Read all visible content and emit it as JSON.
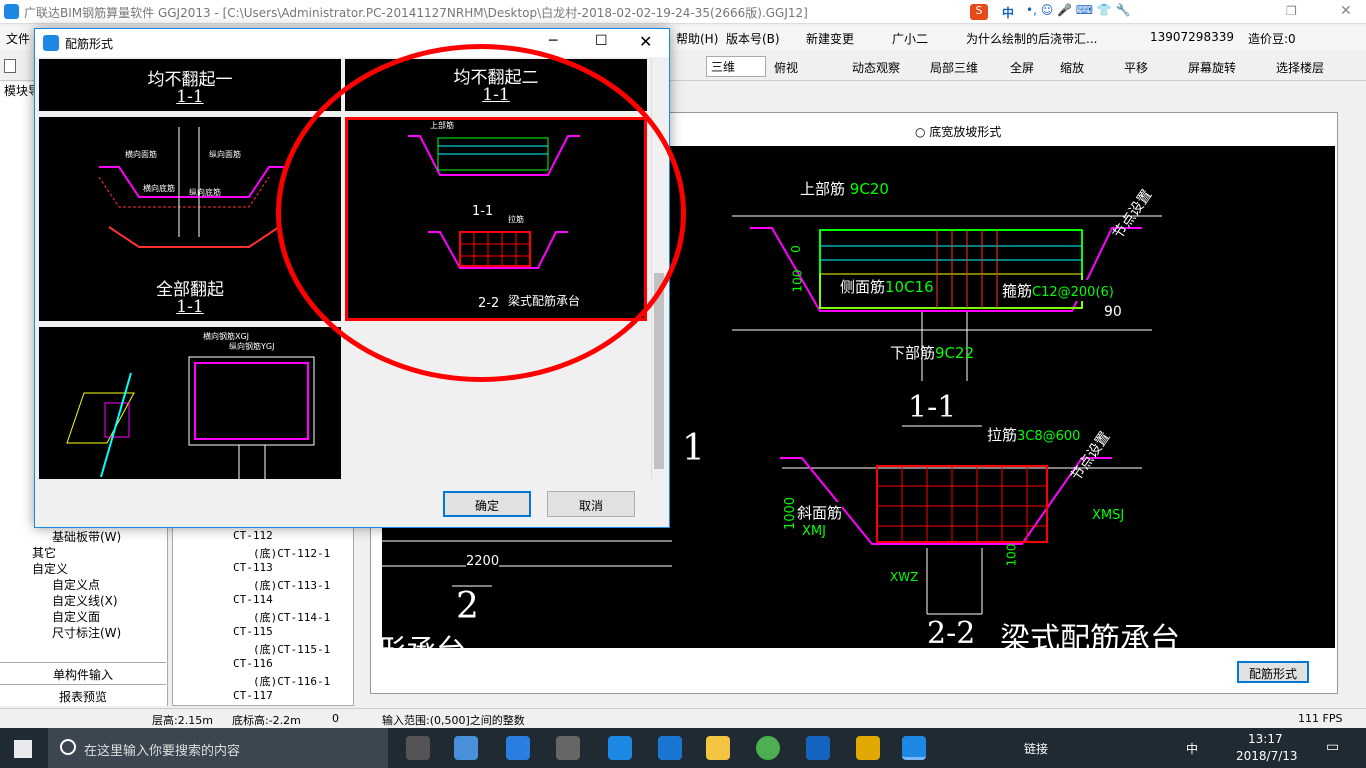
{
  "window": {
    "title": "广联达BIM钢筋算量软件 GGJ2013 - [C:\\Users\\Administrator.PC-20141127NRHM\\Desktop\\白龙村-2018-02-02-19-24-35(2666版).GGJ12]"
  },
  "menu": {
    "file": "文件",
    "help": "帮助(H)",
    "version": "版本号(B)",
    "new_change": "新建变更",
    "guangxiaoer": "广小二",
    "question": "为什么绘制的后浇带汇...",
    "phone": "13907298339",
    "cost_bean": "造价豆:0"
  },
  "ime": {
    "label": "中"
  },
  "toolbar": {
    "view3d": "三维",
    "top_view": "俯视",
    "dynamic": "动态观察",
    "local3d": "局部三维",
    "fullscreen": "全屏",
    "zoom": "缩放",
    "pan": "平移",
    "rotate": "屏幕旋转",
    "select_floor": "选择楼层"
  },
  "left": {
    "module_tab": "模块导",
    "items": [
      {
        "label": "基础板带(W)"
      },
      {
        "label": "其它"
      },
      {
        "label": "自定义"
      },
      {
        "label": "自定义点"
      },
      {
        "label": "自定义线(X)"
      },
      {
        "label": "自定义面"
      },
      {
        "label": "尺寸标注(W)"
      }
    ],
    "single_input": "单构件输入",
    "report_preview": "报表预览"
  },
  "mid_tree": {
    "items": [
      "CT-112",
      "(底)CT-112-1",
      "CT-113",
      "(底)CT-113-1",
      "CT-114",
      "(底)CT-114-1",
      "CT-115",
      "(底)CT-115-1",
      "CT-116",
      "(底)CT-116-1",
      "CT-117"
    ]
  },
  "viewer": {
    "radio_label": "底宽放坡形式",
    "rebar_form_button": "配筋形式",
    "cad": {
      "top_rebar": "上部筋",
      "top_rebar_v": "9C20",
      "node_setting": "节点设置",
      "side_rebar": "侧面筋",
      "side_rebar_v": "10C16",
      "stirrup": "箍筋",
      "stirrup_v": "C12@200(6)",
      "bottom_rebar": "下部筋",
      "bottom_rebar_v": "9C22",
      "angle": "90",
      "zero": "0",
      "dim100": "100",
      "sec11": "1-1",
      "tie": "拉筋",
      "tie_v": "3C8@600",
      "node_setting2": "节点设置",
      "slope": "斜面筋",
      "xmj": "XMJ",
      "xmsj": "XMSJ",
      "xwz": "XWZ",
      "dim1000": "1000",
      "dim100b": "100",
      "left1": "1",
      "left2": "2",
      "dim2200": "2200",
      "sec22": "2-2",
      "caption": "梁式配筋承台",
      "partial_left": "形承台"
    }
  },
  "dialog": {
    "title": "配筋形式",
    "ok": "确定",
    "cancel": "取消",
    "panels": {
      "p1_title": "均不翻起一",
      "p1_sec": "1-1",
      "p2_title": "均不翻起二",
      "p2_sec": "1-1",
      "p3_title": "全部翻起",
      "p3_sec": "1-1",
      "p3_labels": [
        "横向面筋",
        "纵向面筋",
        "横向底筋",
        "纵向底筋"
      ],
      "p4_sec1": "1-1",
      "p4_sec2": "2-2",
      "p4_caption": "梁式配筋承台",
      "p4_labels": [
        "上部筋",
        "拉筋"
      ],
      "p5_labels": [
        "横向钢筋XGJ",
        "纵向钢筋YGJ"
      ]
    }
  },
  "status": {
    "floor_height": "层高:2.15m",
    "base_elev": "底标高:-2.2m",
    "zero": "0",
    "input_range": "输入范围:(0,500]之间的整数",
    "fps": "111 FPS"
  },
  "taskbar": {
    "search_placeholder": "在这里输入你要搜索的内容",
    "link": "链接",
    "ime": "中",
    "time": "13:17",
    "date": "2018/7/13"
  },
  "colors": {
    "accent": "#1e88e5",
    "highlight_red": "#ff0000",
    "cad_bg": "#000000",
    "green_rebar": "#00ff00",
    "magenta": "#ff00ff"
  }
}
